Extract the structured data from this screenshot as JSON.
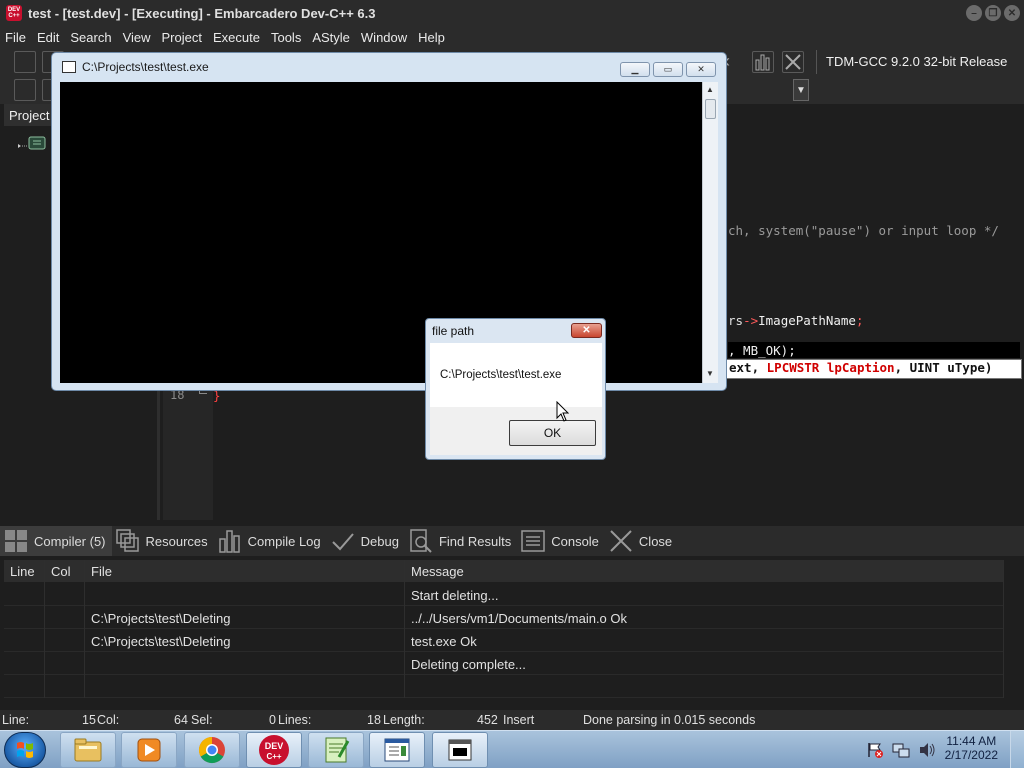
{
  "window": {
    "icon_text": "DEV C++",
    "title": "test - [test.dev] - [Executing] - Embarcadero Dev-C++ 6.3",
    "minimize": "–",
    "restore": "❐",
    "close": "✕"
  },
  "menu": [
    "File",
    "Edit",
    "Search",
    "View",
    "Project",
    "Execute",
    "Tools",
    "AStyle",
    "Window",
    "Help"
  ],
  "toolbar": {
    "compiler": "TDM-GCC 9.2.0 32-bit Release"
  },
  "left_panel": {
    "tab_label": "Project"
  },
  "editor": {
    "line_number": "18",
    "line_a": "ch, system(\"pause\") or input loop */",
    "line_b_1": "rs",
    "line_b_2": "->",
    "line_b_3": "ImagePathName",
    "line_b_4": ";",
    "line_c_1": ", MB_OK);",
    "hint_1": "ext, ",
    "hint_2": "LPCWSTR lpCaption",
    "hint_3": ", UINT uType)",
    "brace": "}"
  },
  "bottom_tabs": [
    {
      "label": "Compiler (5)",
      "icon": "grid-icon"
    },
    {
      "label": "Resources",
      "icon": "resources-icon"
    },
    {
      "label": "Compile Log",
      "icon": "bar-chart-icon"
    },
    {
      "label": "Debug",
      "icon": "check-icon"
    },
    {
      "label": "Find Results",
      "icon": "find-icon"
    },
    {
      "label": "Console",
      "icon": "console-icon"
    },
    {
      "label": "Close",
      "icon": "close-icon"
    }
  ],
  "results": {
    "columns": [
      "Line",
      "Col",
      "File",
      "Message"
    ],
    "rows": [
      {
        "line": "",
        "col": "",
        "file": "",
        "message": "Start deleting..."
      },
      {
        "line": "",
        "col": "",
        "file": "C:\\Projects\\test\\Deleting",
        "message": "../../Users/vm1/Documents/main.o Ok"
      },
      {
        "line": "",
        "col": "",
        "file": "C:\\Projects\\test\\Deleting",
        "message": "test.exe Ok"
      },
      {
        "line": "",
        "col": "",
        "file": "",
        "message": "Deleting complete..."
      }
    ]
  },
  "status": {
    "line_label": "Line:",
    "line_value": "15",
    "col_label": "Col:",
    "col_value": "64",
    "sel_label": "Sel:",
    "sel_value": "0",
    "lines_label": "Lines:",
    "lines_value": "18",
    "length_label": "Length:",
    "length_value": "452",
    "mode": "Insert",
    "message": "Done parsing in 0.015 seconds"
  },
  "console_window": {
    "title": "C:\\Projects\\test\\test.exe",
    "minimize": "▁",
    "maximize": "▭",
    "close": "✕"
  },
  "message_box": {
    "title": "file path",
    "close": "✕",
    "text": "C:\\Projects\\test\\test.exe",
    "ok": "OK"
  },
  "taskbar": {
    "time": "11:44 AM",
    "date": "2/17/2022",
    "apps": [
      "file-explorer-icon",
      "media-player-icon",
      "chrome-icon",
      "devcpp-icon",
      "notepad-plus-icon",
      "document-viewer-icon",
      "console-app-icon"
    ]
  },
  "colors": {
    "background": "#1e1e1e",
    "chrome": "#2b2b2b",
    "keyword_red": "#ff4040",
    "arrow_red": "#ff5a5a",
    "taskbar": "#9ab8d6"
  }
}
